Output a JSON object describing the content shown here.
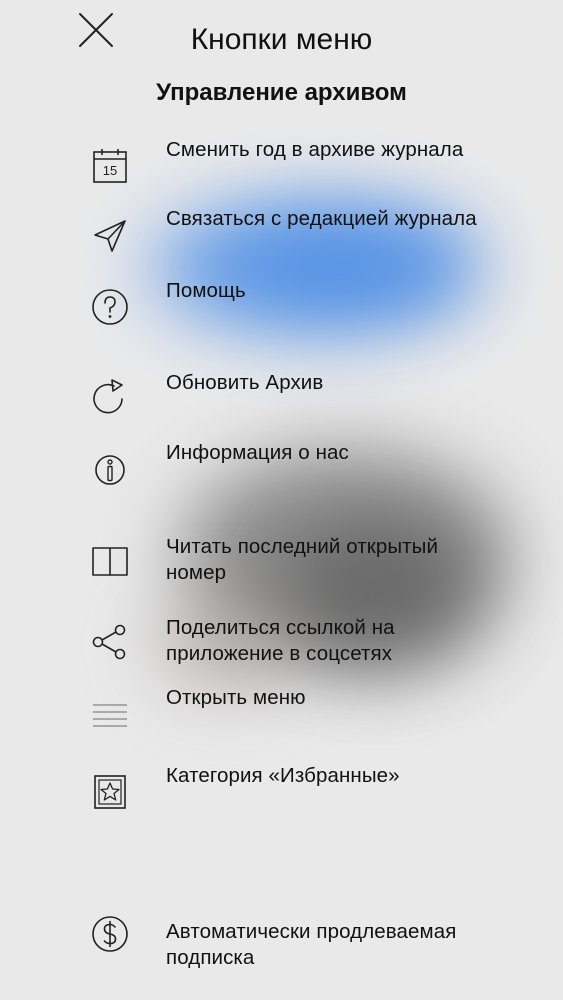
{
  "header": {
    "title": "Кнопки меню",
    "subtitle": "Управление архивом",
    "close_icon": "close-icon"
  },
  "menu": {
    "items": [
      {
        "id": "change-year",
        "label": "Сменить год в архиве журнала",
        "icon": "calendar-icon",
        "icon_text": "15"
      },
      {
        "id": "contact",
        "label": "Связаться с редакцией журнала",
        "icon": "paper-plane-icon"
      },
      {
        "id": "help",
        "label": "Помощь",
        "icon": "question-circle-icon"
      },
      {
        "id": "refresh",
        "label": "Обновить Архив",
        "icon": "refresh-icon"
      },
      {
        "id": "about",
        "label": "Информация о нас",
        "icon": "info-icon"
      },
      {
        "id": "read-last",
        "label": "Читать последний открытый номер",
        "icon": "book-icon"
      },
      {
        "id": "share",
        "label": "Поделиться ссылкой на приложение в соцсетях",
        "icon": "share-icon"
      },
      {
        "id": "open-menu",
        "label": "Открыть меню",
        "icon": "menu-lines-icon"
      },
      {
        "id": "favorites",
        "label": "Категория «Избранные»",
        "icon": "star-frame-icon"
      },
      {
        "id": "subscription",
        "label": "Автоматически продлеваемая подписка",
        "icon": "dollar-circle-icon"
      }
    ]
  }
}
